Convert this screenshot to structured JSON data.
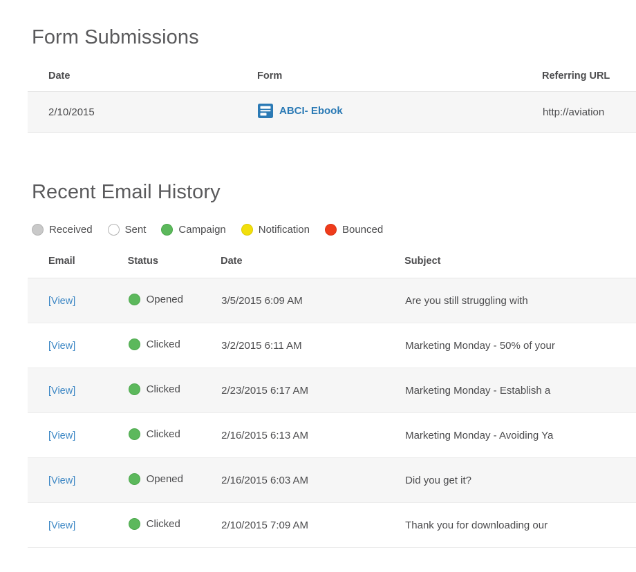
{
  "sections": {
    "form_submissions": {
      "title": "Form Submissions",
      "columns": {
        "date": "Date",
        "form": "Form",
        "referring_url": "Referring URL"
      },
      "rows": [
        {
          "date": "2/10/2015",
          "form_name": "ABCI- Ebook",
          "form_icon": "form-document-icon",
          "referring_url": "http://aviation"
        }
      ]
    },
    "email_history": {
      "title": "Recent Email History",
      "legend": [
        {
          "label": "Received",
          "color": "#c9c9c9",
          "border": "#b3b3b3"
        },
        {
          "label": "Sent",
          "color": "#ffffff",
          "border": "#b3b3b3"
        },
        {
          "label": "Campaign",
          "color": "#5cb85c",
          "border": "#4ca84c"
        },
        {
          "label": "Notification",
          "color": "#f2df0b",
          "border": "#ddcb08"
        },
        {
          "label": "Bounced",
          "color": "#ef3b1b",
          "border": "#d93415"
        }
      ],
      "columns": {
        "email": "Email",
        "status": "Status",
        "date": "Date",
        "subject": "Subject"
      },
      "view_label": "[View]",
      "rows": [
        {
          "view": "[View]",
          "status": "Opened",
          "status_color": "#5cb85c",
          "date": "3/5/2015 6:09 AM",
          "subject": "Are you still struggling with"
        },
        {
          "view": "[View]",
          "status": "Clicked",
          "status_color": "#5cb85c",
          "date": "3/2/2015 6:11 AM",
          "subject": "Marketing Monday - 50% of your"
        },
        {
          "view": "[View]",
          "status": "Clicked",
          "status_color": "#5cb85c",
          "date": "2/23/2015 6:17 AM",
          "subject": "Marketing Monday - Establish a"
        },
        {
          "view": "[View]",
          "status": "Clicked",
          "status_color": "#5cb85c",
          "date": "2/16/2015 6:13 AM",
          "subject": "Marketing Monday - Avoiding Ya"
        },
        {
          "view": "[View]",
          "status": "Opened",
          "status_color": "#5cb85c",
          "date": "2/16/2015 6:03 AM",
          "subject": "Did you get it?"
        },
        {
          "view": "[View]",
          "status": "Clicked",
          "status_color": "#5cb85c",
          "date": "2/10/2015 7:09 AM",
          "subject": "Thank you for downloading our"
        }
      ]
    }
  },
  "colors": {
    "link": "#3b86c4",
    "form_link": "#2b7ab5",
    "text": "#4b4b4d",
    "heading": "#5a5a5c",
    "row_stripe": "#f6f6f6",
    "row_border": "#e6e6e6"
  }
}
